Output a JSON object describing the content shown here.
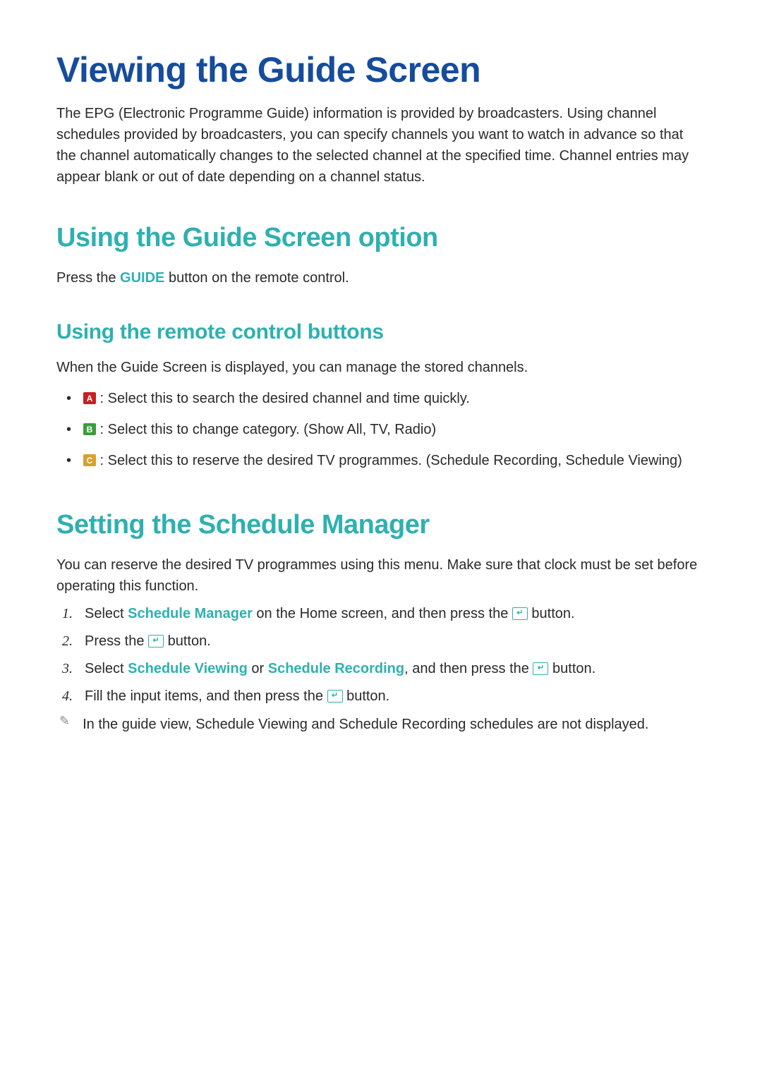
{
  "h1": "Viewing the Guide Screen",
  "intro": "The EPG (Electronic Programme Guide) information is provided by broadcasters. Using channel schedules provided by broadcasters, you can specify channels you want to watch in advance so that the channel automatically changes to the selected channel at the specified time. Channel entries may appear blank or out of date depending on a channel status.",
  "h2_option": "Using the Guide Screen option",
  "press_the": "Press the ",
  "guide_label": "GUIDE",
  "press_suffix": " button on the remote control.",
  "h3_remote": "Using the remote control buttons",
  "remote_intro": "When the Guide Screen is displayed, you can manage the stored channels.",
  "btn_a_label": "A",
  "btn_a_text": " : Select this to search the desired channel and time quickly.",
  "btn_b_label": "B",
  "btn_b_text": " : Select this to change category. (Show All, TV, Radio)",
  "btn_c_label": "C",
  "btn_c_text": " : Select this to reserve the desired TV programmes. (Schedule Recording, Schedule Viewing)",
  "h2_schedule": "Setting the Schedule Manager",
  "schedule_intro": "You can reserve the desired TV programmes using this menu. Make sure that clock must be set before operating this function.",
  "step1_num": "1.",
  "step1_a": "Select ",
  "step1_link": "Schedule Manager",
  "step1_b": " on the Home screen, and then press the ",
  "step1_c": " button.",
  "step2_num": "2.",
  "step2_a": "Press the ",
  "step2_b": " button.",
  "step3_num": "3.",
  "step3_a": "Select ",
  "step3_link1": "Schedule Viewing",
  "step3_b": " or ",
  "step3_link2": "Schedule Recording",
  "step3_c": ", and then press the ",
  "step3_d": " button.",
  "step4_num": "4.",
  "step4_a": "Fill the input items, and then press the ",
  "step4_b": " button.",
  "note_text": "In the guide view, Schedule Viewing and Schedule Recording schedules are not displayed.",
  "enter_glyph": "↵"
}
